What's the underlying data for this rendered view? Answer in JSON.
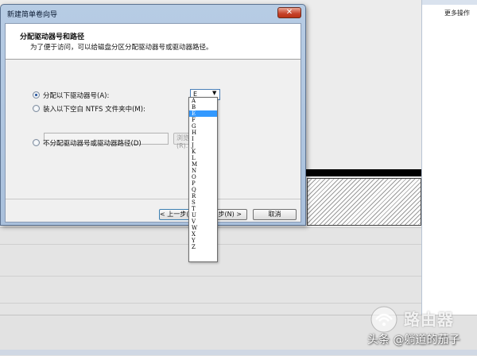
{
  "background": {
    "more_actions": "更多操作"
  },
  "dialog": {
    "title": "新建简单卷向导",
    "close_glyph": "✕",
    "header_title": "分配驱动器号和路径",
    "header_subtitle": "为了便于访问，可以给磁盘分区分配驱动器号或驱动器路径。",
    "options": [
      {
        "label": "分配以下驱动器号(A):",
        "checked": true
      },
      {
        "label": "装入以下空白 NTFS 文件夹中(M):",
        "checked": false
      },
      {
        "label": "不分配驱动器号或驱动器路径(D)",
        "checked": false
      }
    ],
    "drive_combo_value": "E",
    "drive_combo_arrow": "▼",
    "path_value": "",
    "browse_label": "浏览(R)...",
    "back_label": "< 上一步(B)",
    "next_label": "步(N) >",
    "cancel_label": "取消"
  },
  "drive_list": {
    "items": [
      "A",
      "B",
      "E",
      "F",
      "G",
      "H",
      "I",
      "J",
      "K",
      "L",
      "M",
      "N",
      "O",
      "P",
      "Q",
      "R",
      "S",
      "T",
      "U",
      "V",
      "W",
      "X",
      "Y",
      "Z"
    ],
    "selected_index": 2
  },
  "watermark": {
    "site_text": "路由器",
    "author_text": "头条 @躺道的茄子"
  }
}
